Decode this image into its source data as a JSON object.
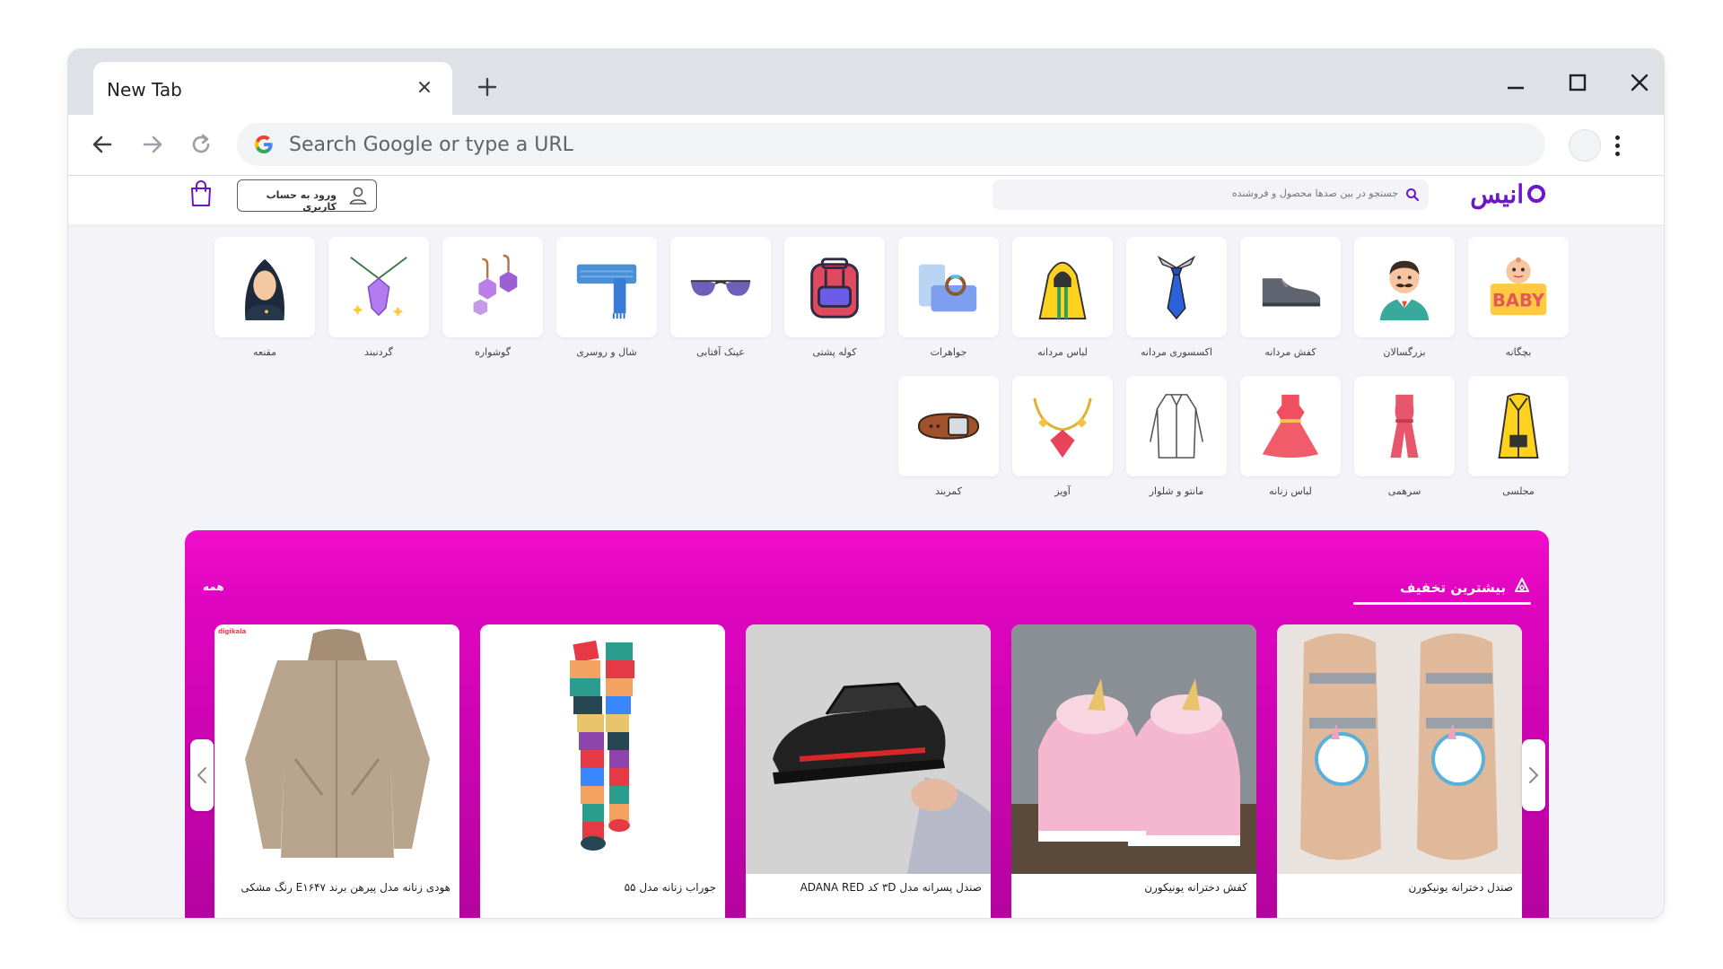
{
  "browser": {
    "tab_title": "New Tab",
    "omnibox_placeholder": "Search Google or type a URL"
  },
  "site": {
    "logo_text": "انیس",
    "search_placeholder": "جستجو در بین صدها محصول و فروشنده",
    "login_label": "ورود به حساب کاربری"
  },
  "categories": [
    {
      "label": "بچگانه",
      "icon": "baby-icon"
    },
    {
      "label": "بزرگسالان",
      "icon": "man-mustache-icon"
    },
    {
      "label": "کفش مردانه",
      "icon": "mens-shoe-icon"
    },
    {
      "label": "اکسسوری مردانه",
      "icon": "tie-icon"
    },
    {
      "label": "لباس مردانه",
      "icon": "raincoat-icon"
    },
    {
      "label": "جواهرات",
      "icon": "jewelry-box-icon"
    },
    {
      "label": "کوله پشتی",
      "icon": "backpack-icon"
    },
    {
      "label": "عینک آفتابی",
      "icon": "sunglasses-icon"
    },
    {
      "label": "شال و روسری",
      "icon": "scarf-icon"
    },
    {
      "label": "گوشواره",
      "icon": "earrings-icon"
    },
    {
      "label": "گردنبند",
      "icon": "necklace-icon"
    },
    {
      "label": "مقنعه",
      "icon": "hijab-icon"
    },
    {
      "label": "مجلسی",
      "icon": "formal-coat-icon"
    },
    {
      "label": "سرهمی",
      "icon": "jumpsuit-icon"
    },
    {
      "label": "لباس زنانه",
      "icon": "dress-icon"
    },
    {
      "label": "مانتو و شلوار",
      "icon": "long-coat-icon"
    },
    {
      "label": "آویز",
      "icon": "pendant-icon"
    },
    {
      "label": "کمربند",
      "icon": "belt-icon"
    }
  ],
  "deals": {
    "title": "بیشترین تخفیف",
    "all_label": "همه",
    "products": [
      {
        "name": "صندل دخترانه یونیکورن",
        "image": "unicorn-sandals-image"
      },
      {
        "name": "کفش دخترانه یونیکورن",
        "image": "unicorn-shoes-image"
      },
      {
        "name": "صندل پسرانه مدل ۳D کد ADANA RED",
        "image": "boys-sandal-image"
      },
      {
        "name": "جوراب زنانه مدل ۵۵",
        "image": "rainbow-socks-image"
      },
      {
        "name": "هودی زنانه مدل پیرهن برند E۱۶۴۷ رنگ مشکی",
        "image": "womens-hoodie-image"
      }
    ]
  },
  "colors": {
    "brand": "#6a16c9",
    "deals_gradient_top": "#f20ccc",
    "deals_gradient_bottom": "#b3039f",
    "page_bg": "#f3f3f8"
  }
}
